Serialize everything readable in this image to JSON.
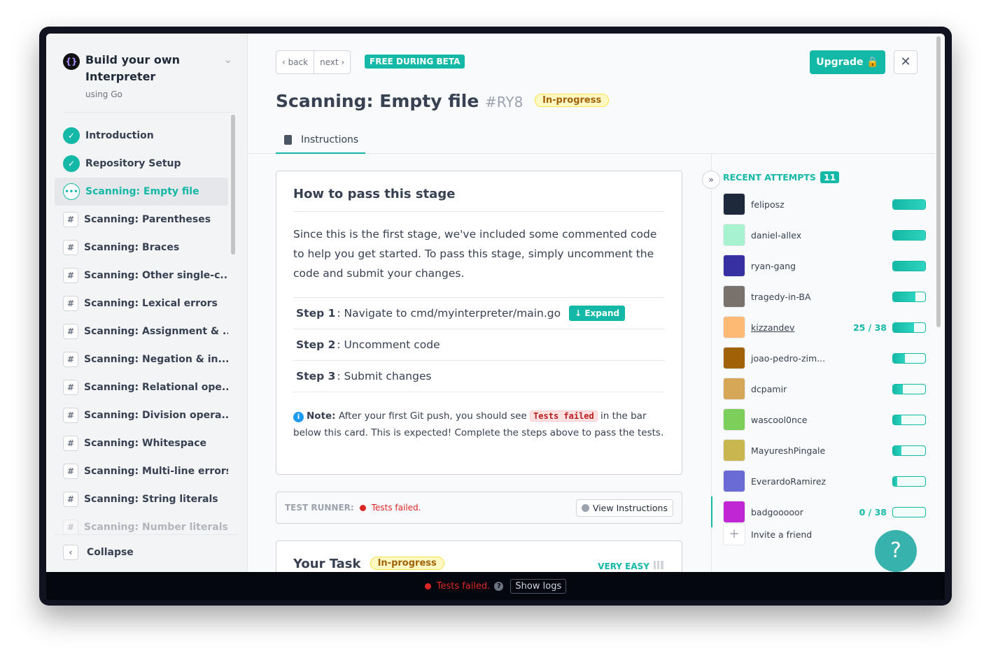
{
  "course": {
    "title": "Build your own Interpreter",
    "subtitle": "using Go",
    "logo": "{}"
  },
  "stages": [
    {
      "label": "Introduction",
      "status": "done"
    },
    {
      "label": "Repository Setup",
      "status": "done"
    },
    {
      "label": "Scanning: Empty file",
      "status": "current"
    },
    {
      "label": "Scanning: Parentheses",
      "status": "locked"
    },
    {
      "label": "Scanning: Braces",
      "status": "locked"
    },
    {
      "label": "Scanning: Other single-c...",
      "status": "locked"
    },
    {
      "label": "Scanning: Lexical errors",
      "status": "locked"
    },
    {
      "label": "Scanning: Assignment & ...",
      "status": "locked"
    },
    {
      "label": "Scanning: Negation & in...",
      "status": "locked"
    },
    {
      "label": "Scanning: Relational ope...",
      "status": "locked"
    },
    {
      "label": "Scanning: Division opera...",
      "status": "locked"
    },
    {
      "label": "Scanning: Whitespace",
      "status": "locked"
    },
    {
      "label": "Scanning: Multi-line errors",
      "status": "locked"
    },
    {
      "label": "Scanning: String literals",
      "status": "locked"
    },
    {
      "label": "Scanning: Number literals",
      "status": "locked"
    }
  ],
  "sidebar": {
    "collapse": "Collapse"
  },
  "header": {
    "back": "‹ back",
    "next": "next ›",
    "beta": "FREE DURING BETA",
    "upgrade": "Upgrade 🔒",
    "close": "✕",
    "title": "Scanning: Empty file",
    "id": "#RY8",
    "status": "In-progress"
  },
  "tabs": {
    "instructions": "Instructions"
  },
  "card": {
    "heading": "How to pass this stage",
    "intro": "Since this is the first stage, we've included some commented code to help you get started. To pass this stage, simply uncomment the code and submit your changes.",
    "steps": [
      {
        "label": "Step 1",
        "text": ": Navigate to cmd/myinterpreter/main.go"
      },
      {
        "label": "Step 2",
        "text": ": Uncomment code"
      },
      {
        "label": "Step 3",
        "text": ": Submit changes"
      }
    ],
    "expand": "↓ Expand",
    "note_label": "Note:",
    "note_pre": " After your first Git push, you should see ",
    "note_code": "Tests failed",
    "note_post": " in the bar below this card. This is expected! Complete the steps above to pass the tests."
  },
  "runner": {
    "label": "TEST RUNNER:",
    "status": "Tests failed.",
    "view": "View Instructions"
  },
  "task": {
    "title": "Your Task",
    "status": "In-progress",
    "difficulty": "VERY EASY"
  },
  "attempts": {
    "title": "RECENT ATTEMPTS",
    "count": "11",
    "invite": "Invite a friend",
    "items": [
      {
        "name": "feliposz",
        "progress": 1.0,
        "avatar": "#1e293b"
      },
      {
        "name": "daniel-allex",
        "progress": 1.0,
        "avatar": "#a7f3d0"
      },
      {
        "name": "ryan-gang",
        "progress": 1.0,
        "avatar": "#3730a3"
      },
      {
        "name": "tragedy-in-BA",
        "progress": 0.7,
        "avatar": "#78716c"
      },
      {
        "name": "kizzandev",
        "score": "25 / 38",
        "progress": 0.66,
        "avatar": "#fdba74"
      },
      {
        "name": "joao-pedro-zim...",
        "progress": 0.38,
        "avatar": "#a16207"
      },
      {
        "name": "dcpamir",
        "progress": 0.3,
        "avatar": "#d6a756"
      },
      {
        "name": "wascool0nce",
        "progress": 0.25,
        "avatar": "#7ccf5b"
      },
      {
        "name": "MayureshPingale",
        "progress": 0.25,
        "avatar": "#c9b64f"
      },
      {
        "name": "EverardoRamirez",
        "progress": 0.12,
        "avatar": "#6b6bd6"
      },
      {
        "name": "badgooooor",
        "score": "0 / 38",
        "progress": 0,
        "avatar": "#c026d3"
      }
    ]
  },
  "help": "?",
  "bottom": {
    "status": "Tests failed.",
    "help": "?",
    "logs": "Show logs"
  }
}
